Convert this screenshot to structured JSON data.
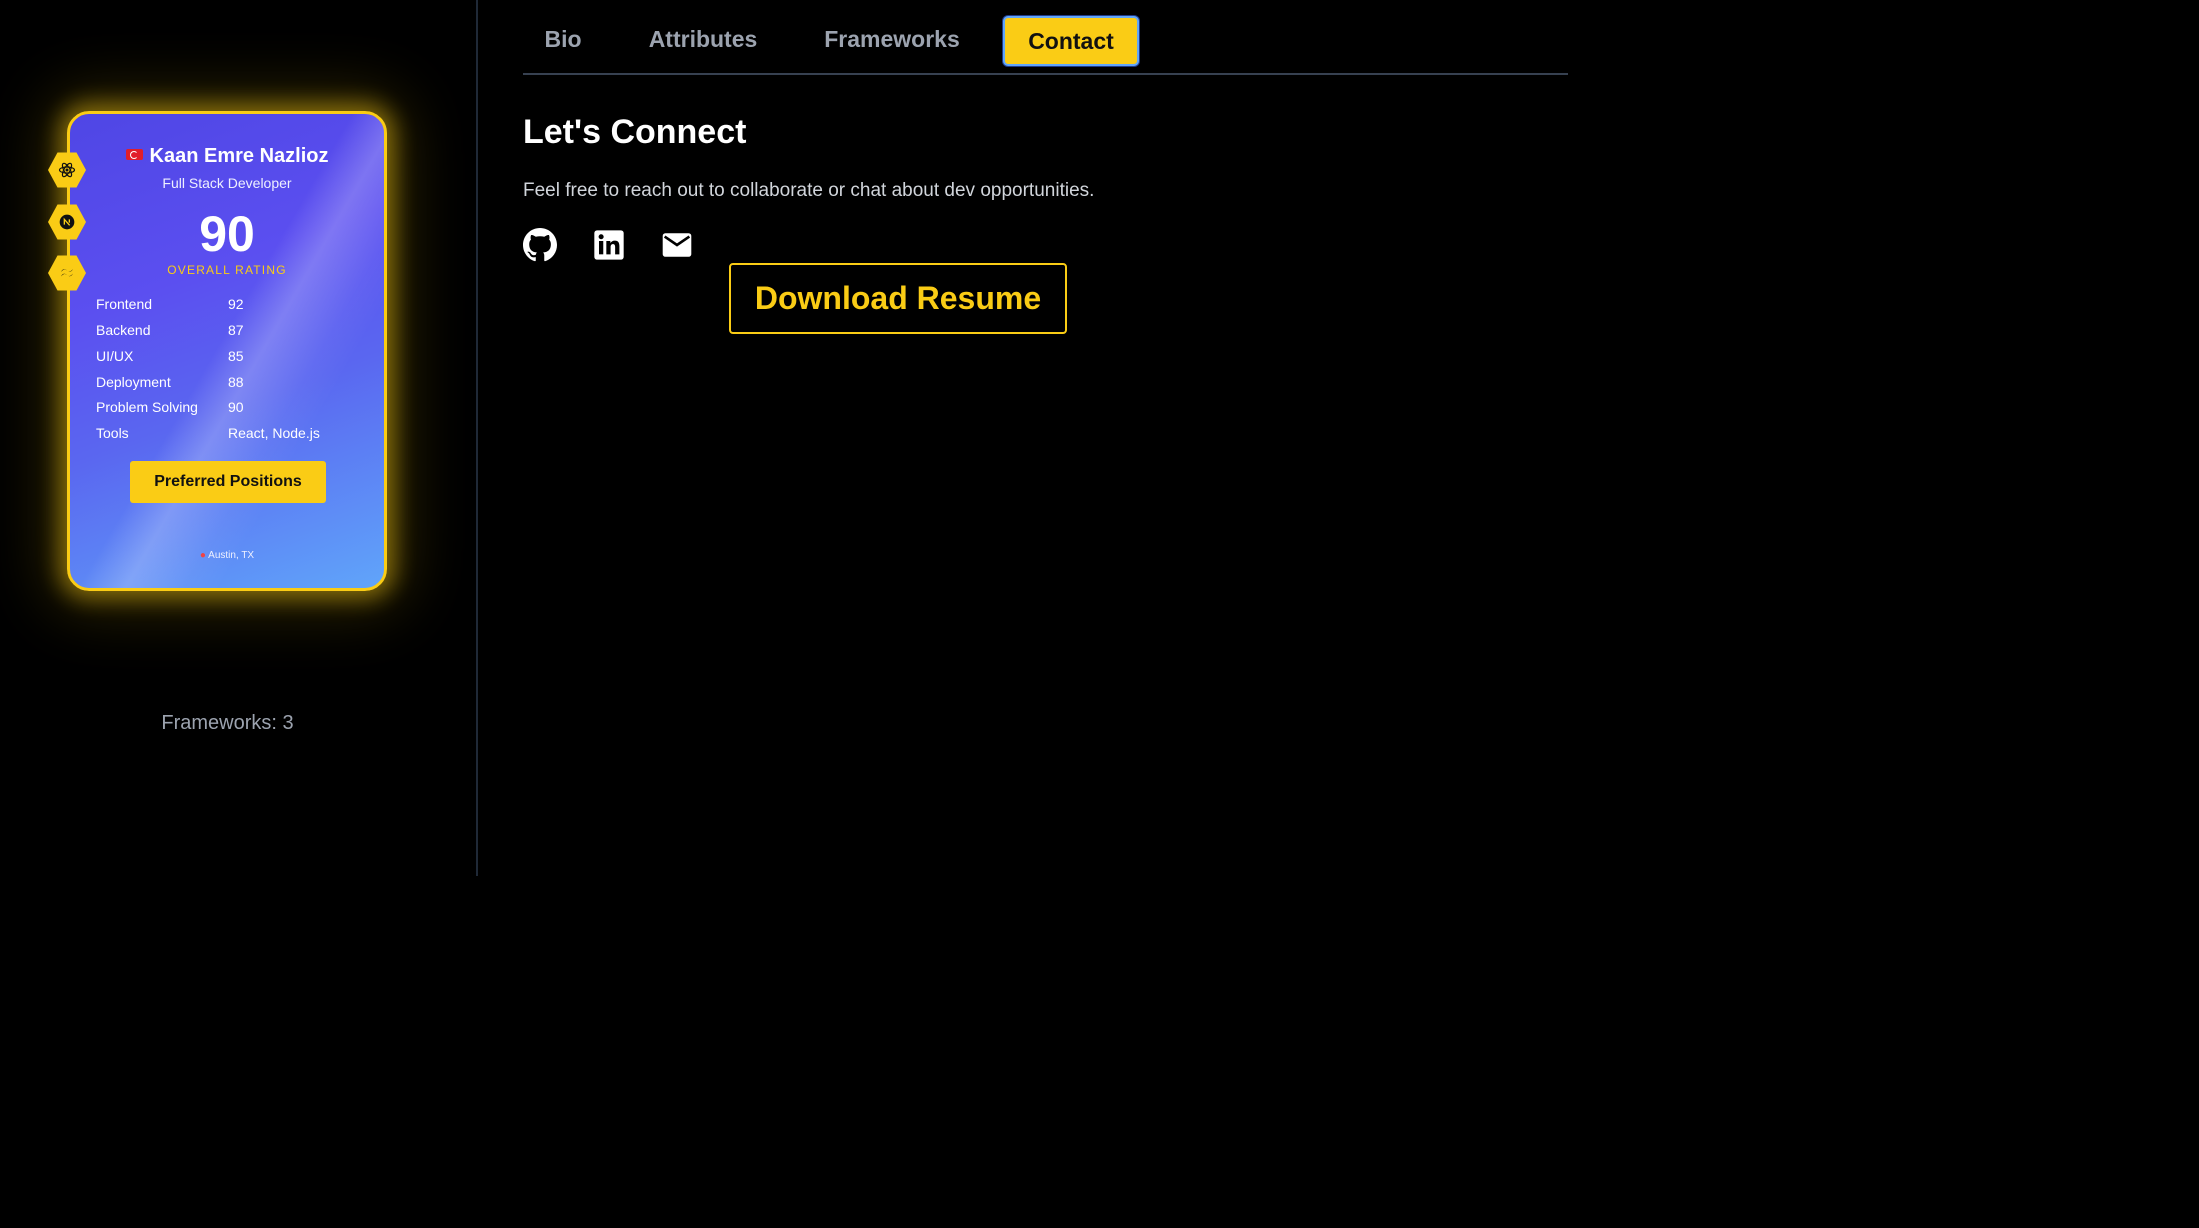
{
  "card": {
    "name": "Kaan Emre Nazlioz",
    "role": "Full Stack Developer",
    "overall_rating": "90",
    "overall_label": "OVERALL RATING",
    "stats": [
      {
        "label": "Frontend",
        "value": "92"
      },
      {
        "label": "Backend",
        "value": "87"
      },
      {
        "label": "UI/UX",
        "value": "85"
      },
      {
        "label": "Deployment",
        "value": "88"
      },
      {
        "label": "Problem Solving",
        "value": "90"
      },
      {
        "label": "Tools",
        "value": "React, Node.js"
      }
    ],
    "preferred_button": "Preferred Positions",
    "location": "Austin, TX",
    "badges": [
      "react-icon",
      "nextjs-icon",
      "tailwind-icon"
    ],
    "accent_color": "#facc15"
  },
  "sidebar": {
    "frameworks_count": "Frameworks: 3"
  },
  "tabs": [
    {
      "label": "Bio",
      "active": false
    },
    {
      "label": "Attributes",
      "active": false
    },
    {
      "label": "Frameworks",
      "active": false
    },
    {
      "label": "Contact",
      "active": true
    }
  ],
  "contact": {
    "heading": "Let's Connect",
    "subtext": "Feel free to reach out to collaborate or chat about dev opportunities.",
    "socials": [
      "github-icon",
      "linkedin-icon",
      "email-icon"
    ],
    "download_button": "Download Resume"
  }
}
